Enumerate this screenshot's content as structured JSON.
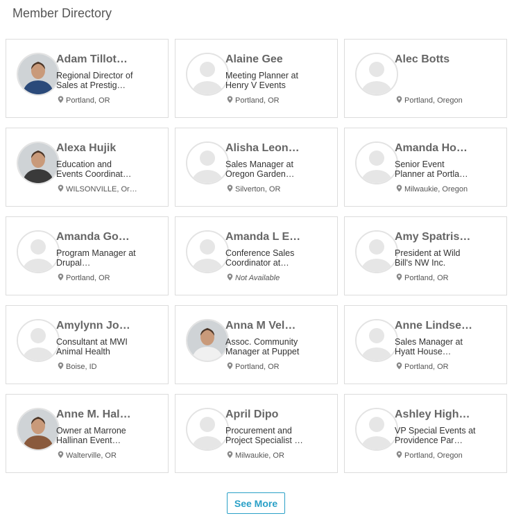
{
  "header": {
    "title": "Member Directory"
  },
  "colors": {
    "accent": "#2aa0c7",
    "placeholder_avatar": "#e6e6e6"
  },
  "members": [
    {
      "name": "Adam Tillot…",
      "title": "Regional Director of Sales at Prestig…",
      "location": "Portland, OR",
      "avatar": "photo",
      "photo_tone": "#2b4a7a"
    },
    {
      "name": "Alaine Gee",
      "title": "Meeting Planner at Henry V Events",
      "location": "Portland, OR",
      "avatar": "placeholder"
    },
    {
      "name": "Alec Botts",
      "title": "",
      "location": "Portland, Oregon",
      "avatar": "placeholder"
    },
    {
      "name": "Alexa Hujik",
      "title": "Education and Events Coordinat…",
      "location": "WILSONVILLE, Or…",
      "avatar": "photo",
      "photo_tone": "#3a3a3a"
    },
    {
      "name": "Alisha Leon…",
      "title": "Sales Manager at Oregon Garden…",
      "location": "Silverton, OR",
      "avatar": "placeholder"
    },
    {
      "name": "Amanda Ho…",
      "title": "Senior Event Planner at Portla…",
      "location": "Milwaukie, Oregon",
      "avatar": "placeholder"
    },
    {
      "name": "Amanda Go…",
      "title": "Program Manager at Drupal…",
      "location": "Portland, OR",
      "avatar": "placeholder"
    },
    {
      "name": "Amanda L E…",
      "title": "Conference Sales Coordinator at…",
      "location": "Not Available",
      "location_missing": true,
      "avatar": "placeholder"
    },
    {
      "name": "Amy Spatris…",
      "title": "President at Wild Bill's NW Inc.",
      "location": "Portland, OR",
      "avatar": "placeholder"
    },
    {
      "name": "Amylynn Jo…",
      "title": "Consultant at MWI Animal Health",
      "location": "Boise, ID",
      "avatar": "placeholder"
    },
    {
      "name": "Anna M Vel…",
      "title": "Assoc. Community Manager at Puppet",
      "location": "Portland, OR",
      "avatar": "photo",
      "photo_tone": "#f0f0f0"
    },
    {
      "name": "Anne Lindse…",
      "title": "Sales Manager at Hyatt House…",
      "location": "Portland, OR",
      "avatar": "placeholder"
    },
    {
      "name": "Anne M. Hal…",
      "title": "Owner at Marrone Hallinan Event…",
      "location": "Walterville, OR",
      "avatar": "photo",
      "photo_tone": "#8a5a3c"
    },
    {
      "name": "April Dipo",
      "title": "Procurement and Project Specialist …",
      "location": "Milwaukie, OR",
      "avatar": "placeholder"
    },
    {
      "name": "Ashley High…",
      "title": "VP Special Events at Providence Par…",
      "location": "Portland, Oregon",
      "avatar": "placeholder"
    }
  ],
  "footer": {
    "see_more_label": "See More"
  }
}
